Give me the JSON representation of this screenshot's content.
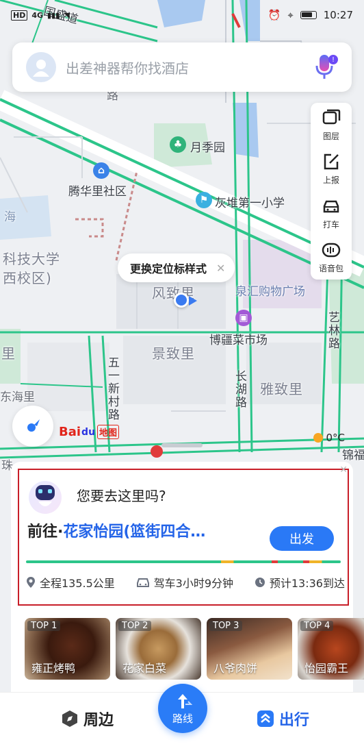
{
  "status_bar": {
    "network": "HD",
    "signal": "4G",
    "time": "10:27"
  },
  "search": {
    "placeholder": "出差神器帮你找酒店"
  },
  "map_tools": [
    {
      "label": "图层",
      "icon": "layers-icon"
    },
    {
      "label": "上报",
      "icon": "report-icon"
    },
    {
      "label": "打车",
      "icon": "taxi-icon"
    },
    {
      "label": "语音包",
      "icon": "voice-pack-icon"
    }
  ],
  "location_tip": {
    "text": "更换定位标样式"
  },
  "map_labels": {
    "road_top": "国盛道",
    "yueji_park": "月季园",
    "tenghuali": "腾华里社区",
    "school": "灰堆第一小学",
    "tech_univ": "科技大学",
    "west_campus": "西校区)",
    "fengzhili": "风致里",
    "quanhui": "泉汇购物广场",
    "market": "博疆菜市场",
    "jingzhili": "景致里",
    "yazhili": "雅致里",
    "wuyi_road": "五一新村路",
    "changhu_road": "长湖路",
    "yilin_road": "艺林路",
    "donghaili": "东海里",
    "li_left": "里",
    "hai": "海",
    "jinxiu": "锦福",
    "road_small": "路",
    "zhu": "珠"
  },
  "map_logo": {
    "bai": "Bai",
    "du": "du",
    "ditu": "地图"
  },
  "weather": {
    "temp": "0°C"
  },
  "destination": {
    "question": "您要去这里吗?",
    "prefix": "前往·",
    "name": "花家怡园(篮街四合…",
    "go_label": "出发",
    "distance": "全程135.5公里",
    "drive_time": "驾车3小时9分钟",
    "eta": "预计13:36到达"
  },
  "food": [
    {
      "rank": "TOP 1",
      "name": "雍正烤鸭"
    },
    {
      "rank": "TOP 2",
      "name": "花家白菜"
    },
    {
      "rank": "TOP 3",
      "name": "八爷肉饼"
    },
    {
      "rank": "TOP 4",
      "name": "怡园霸王"
    }
  ],
  "nav": {
    "nearby": "周边",
    "route": "路线",
    "trip": "出行"
  },
  "colors": {
    "accent": "#2a7cf7",
    "road_green": "#2cc58a",
    "highlight_border": "#c81e28"
  }
}
